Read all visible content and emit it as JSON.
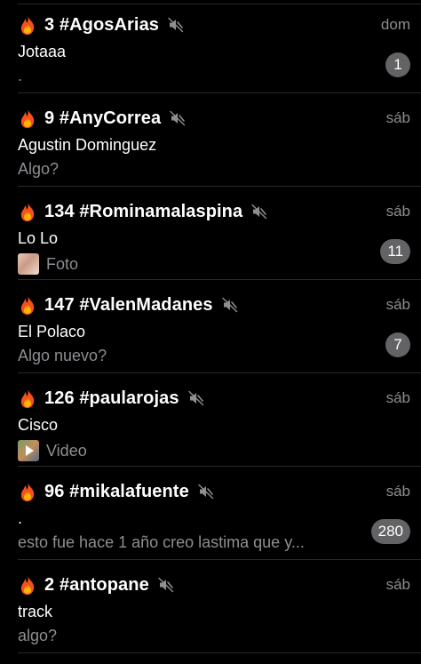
{
  "chats": [
    {
      "title": "3 #AgosArias",
      "time": "dom",
      "sender": "Jotaaa",
      "preview": ".",
      "media": "",
      "unread": "1"
    },
    {
      "title": "9 #AnyCorrea",
      "time": "sáb",
      "sender": "Agustin Dominguez",
      "preview": "Algo?",
      "media": "",
      "unread": ""
    },
    {
      "title": "134 #Rominamalaspina",
      "time": "sáb",
      "sender": "Lo Lo",
      "preview": "Foto",
      "media": "photo",
      "unread": "11"
    },
    {
      "title": "147 #ValenMadanes",
      "time": "sáb",
      "sender": "El Polaco",
      "preview": "Algo nuevo?",
      "media": "",
      "unread": "7"
    },
    {
      "title": "126 #paularojas",
      "time": "sáb",
      "sender": "Cisco",
      "preview": "Video",
      "media": "video",
      "unread": ""
    },
    {
      "title": "96 #mikalafuente",
      "time": "sáb",
      "sender": ".",
      "preview": "esto fue hace 1 año creo lastima que y...",
      "media": "",
      "unread": "280"
    },
    {
      "title": "2 #antopane",
      "time": "sáb",
      "sender": "track",
      "preview": "algo?",
      "media": "",
      "unread": ""
    }
  ],
  "icons": {
    "title_prefix": "fire-icon",
    "muted": "muted-speaker-icon"
  },
  "colors": {
    "background": "#000000",
    "primary_text": "#ffffff",
    "secondary_text": "#8e8e93",
    "badge": "#636366",
    "separator": "#2a2a2c"
  }
}
